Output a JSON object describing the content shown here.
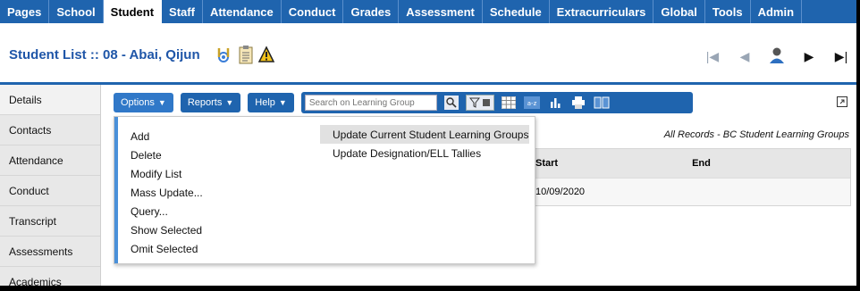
{
  "nav": {
    "tabs": [
      "Pages",
      "School",
      "Student",
      "Staff",
      "Attendance",
      "Conduct",
      "Grades",
      "Assessment",
      "Schedule",
      "Extracurriculars",
      "Global",
      "Tools",
      "Admin"
    ],
    "active": "Student"
  },
  "header": {
    "title": "Student List :: 08 - Abai, Qijun",
    "icons": [
      "medical-icon",
      "notepad-icon",
      "alert-bell-icon"
    ]
  },
  "record_nav": [
    "first-record-icon",
    "previous-record-icon",
    "student-profile-icon",
    "next-record-icon",
    "last-record-icon"
  ],
  "sidebar": {
    "items": [
      "Details",
      "Contacts",
      "Attendance",
      "Conduct",
      "Transcript",
      "Assessments",
      "Academics"
    ]
  },
  "toolbar": {
    "options_label": "Options",
    "reports_label": "Reports",
    "help_label": "Help",
    "search_placeholder": "Search on Learning Group",
    "icons": [
      "search-icon",
      "filter-icon",
      "grid-icon",
      "sort-az-icon",
      "chart-icon",
      "print-icon",
      "book-icon"
    ]
  },
  "records_label": "All Records - BC Student Learning Groups",
  "table": {
    "columns": [
      "Start",
      "End"
    ],
    "rows": [
      [
        "10/09/2020",
        ""
      ]
    ]
  },
  "options_menu": {
    "column1": [
      "Add",
      "Delete",
      "Modify List",
      "Mass Update...",
      "Query...",
      "Show Selected",
      "Omit Selected"
    ],
    "column2": [
      "Update Current Student Learning Groups",
      "Update Designation/ELL Tallies"
    ],
    "highlighted": "Update Current Student Learning Groups"
  },
  "colors": {
    "nav_bg": "#1f64ae",
    "title": "#1f56a8",
    "menu_accent": "#4a90d9"
  }
}
